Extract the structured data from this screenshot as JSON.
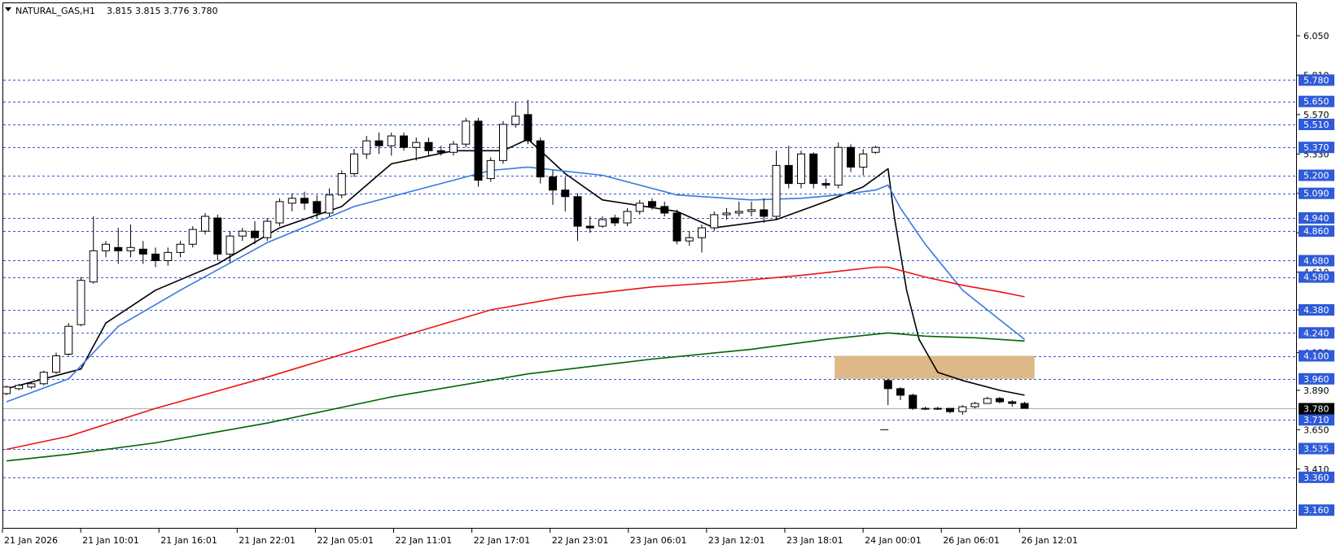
{
  "header": {
    "symbol": "NATURAL_GAS,H1",
    "ohlc": "3.815 3.815 3.776 3.780"
  },
  "price_axis": {
    "ticks": [
      "6.050",
      "5.810",
      "5.570",
      "5.330",
      "5.090",
      "4.850",
      "4.610",
      "4.380",
      "4.120",
      "3.890",
      "3.650",
      "3.410"
    ],
    "level_labels": [
      "5.780",
      "5.650",
      "5.510",
      "5.370",
      "5.200",
      "5.090",
      "4.940",
      "4.860",
      "4.680",
      "4.580",
      "4.380",
      "4.240",
      "4.100",
      "3.960",
      "3.710",
      "3.535",
      "3.360",
      "3.160"
    ],
    "current_price": "3.780"
  },
  "time_axis": {
    "labels": [
      "21 Jan 2026",
      "21 Jan 10:01",
      "21 Jan 16:01",
      "21 Jan 22:01",
      "22 Jan 05:01",
      "22 Jan 11:01",
      "22 Jan 17:01",
      "22 Jan 23:01",
      "23 Jan 06:01",
      "23 Jan 12:01",
      "23 Jan 18:01",
      "24 Jan 00:01",
      "26 Jan 06:01",
      "26 Jan 12:01"
    ]
  },
  "colors": {
    "background": "#ffffff",
    "level_lines": "#2f5bd8",
    "label_box": "#2f5bd8",
    "zone": "#deb887",
    "ma_fast": "#000000",
    "ma_mid": "#3a78e0",
    "ma_slow": "#ee1111",
    "ma_long": "#006400"
  },
  "chart_data": {
    "type": "candlestick",
    "symbol": "NATURAL_GAS",
    "timeframe": "H1",
    "price_range": [
      3.08,
      6.28
    ],
    "candles": [
      {
        "o": 3.87,
        "h": 3.92,
        "l": 3.86,
        "c": 3.91
      },
      {
        "o": 3.9,
        "h": 3.93,
        "l": 3.89,
        "c": 3.92
      },
      {
        "o": 3.91,
        "h": 3.94,
        "l": 3.9,
        "c": 3.93
      },
      {
        "o": 3.93,
        "h": 4.01,
        "l": 3.92,
        "c": 4.0
      },
      {
        "o": 4.0,
        "h": 4.12,
        "l": 3.99,
        "c": 4.1
      },
      {
        "o": 4.11,
        "h": 4.3,
        "l": 4.1,
        "c": 4.28
      },
      {
        "o": 4.29,
        "h": 4.58,
        "l": 4.28,
        "c": 4.56
      },
      {
        "o": 4.55,
        "h": 4.95,
        "l": 4.54,
        "c": 4.74
      },
      {
        "o": 4.74,
        "h": 4.8,
        "l": 4.7,
        "c": 4.78
      },
      {
        "o": 4.76,
        "h": 4.88,
        "l": 4.66,
        "c": 4.74
      },
      {
        "o": 4.74,
        "h": 4.9,
        "l": 4.7,
        "c": 4.76
      },
      {
        "o": 4.75,
        "h": 4.8,
        "l": 4.66,
        "c": 4.72
      },
      {
        "o": 4.72,
        "h": 4.76,
        "l": 4.64,
        "c": 4.68
      },
      {
        "o": 4.68,
        "h": 4.76,
        "l": 4.65,
        "c": 4.73
      },
      {
        "o": 4.73,
        "h": 4.8,
        "l": 4.7,
        "c": 4.78
      },
      {
        "o": 4.78,
        "h": 4.89,
        "l": 4.76,
        "c": 4.87
      },
      {
        "o": 4.86,
        "h": 4.97,
        "l": 4.84,
        "c": 4.95
      },
      {
        "o": 4.94,
        "h": 4.96,
        "l": 4.68,
        "c": 4.72
      },
      {
        "o": 4.72,
        "h": 4.86,
        "l": 4.67,
        "c": 4.83
      },
      {
        "o": 4.83,
        "h": 4.88,
        "l": 4.8,
        "c": 4.86
      },
      {
        "o": 4.86,
        "h": 4.92,
        "l": 4.78,
        "c": 4.82
      },
      {
        "o": 4.82,
        "h": 4.94,
        "l": 4.8,
        "c": 4.92
      },
      {
        "o": 4.91,
        "h": 5.06,
        "l": 4.89,
        "c": 5.04
      },
      {
        "o": 5.03,
        "h": 5.09,
        "l": 4.98,
        "c": 5.06
      },
      {
        "o": 5.06,
        "h": 5.1,
        "l": 4.99,
        "c": 5.03
      },
      {
        "o": 5.04,
        "h": 5.08,
        "l": 4.94,
        "c": 4.97
      },
      {
        "o": 4.97,
        "h": 5.12,
        "l": 4.95,
        "c": 5.08
      },
      {
        "o": 5.08,
        "h": 5.23,
        "l": 5.06,
        "c": 5.21
      },
      {
        "o": 5.21,
        "h": 5.36,
        "l": 5.19,
        "c": 5.33
      },
      {
        "o": 5.33,
        "h": 5.44,
        "l": 5.3,
        "c": 5.41
      },
      {
        "o": 5.41,
        "h": 5.46,
        "l": 5.33,
        "c": 5.38
      },
      {
        "o": 5.38,
        "h": 5.46,
        "l": 5.32,
        "c": 5.44
      },
      {
        "o": 5.44,
        "h": 5.46,
        "l": 5.35,
        "c": 5.37
      },
      {
        "o": 5.37,
        "h": 5.43,
        "l": 5.29,
        "c": 5.4
      },
      {
        "o": 5.4,
        "h": 5.43,
        "l": 5.32,
        "c": 5.35
      },
      {
        "o": 5.35,
        "h": 5.38,
        "l": 5.32,
        "c": 5.34
      },
      {
        "o": 5.34,
        "h": 5.41,
        "l": 5.32,
        "c": 5.39
      },
      {
        "o": 5.39,
        "h": 5.55,
        "l": 5.37,
        "c": 5.53
      },
      {
        "o": 5.53,
        "h": 5.55,
        "l": 5.13,
        "c": 5.17
      },
      {
        "o": 5.18,
        "h": 5.31,
        "l": 5.16,
        "c": 5.29
      },
      {
        "o": 5.29,
        "h": 5.53,
        "l": 5.27,
        "c": 5.51
      },
      {
        "o": 5.51,
        "h": 5.65,
        "l": 5.49,
        "c": 5.56
      },
      {
        "o": 5.57,
        "h": 5.66,
        "l": 5.39,
        "c": 5.41
      },
      {
        "o": 5.41,
        "h": 5.43,
        "l": 5.15,
        "c": 5.19
      },
      {
        "o": 5.19,
        "h": 5.23,
        "l": 5.02,
        "c": 5.11
      },
      {
        "o": 5.11,
        "h": 5.19,
        "l": 4.98,
        "c": 5.07
      },
      {
        "o": 5.07,
        "h": 5.09,
        "l": 4.8,
        "c": 4.89
      },
      {
        "o": 4.89,
        "h": 4.95,
        "l": 4.85,
        "c": 4.88
      },
      {
        "o": 4.89,
        "h": 4.95,
        "l": 4.88,
        "c": 4.93
      },
      {
        "o": 4.94,
        "h": 4.96,
        "l": 4.89,
        "c": 4.91
      },
      {
        "o": 4.91,
        "h": 5.0,
        "l": 4.89,
        "c": 4.98
      },
      {
        "o": 4.98,
        "h": 5.05,
        "l": 4.96,
        "c": 5.03
      },
      {
        "o": 5.04,
        "h": 5.06,
        "l": 4.99,
        "c": 5.01
      },
      {
        "o": 5.01,
        "h": 5.04,
        "l": 4.95,
        "c": 4.97
      },
      {
        "o": 4.97,
        "h": 4.99,
        "l": 4.78,
        "c": 4.8
      },
      {
        "o": 4.8,
        "h": 4.86,
        "l": 4.77,
        "c": 4.82
      },
      {
        "o": 4.82,
        "h": 4.9,
        "l": 4.73,
        "c": 4.88
      },
      {
        "o": 4.88,
        "h": 4.98,
        "l": 4.86,
        "c": 4.96
      },
      {
        "o": 4.96,
        "h": 5.0,
        "l": 4.93,
        "c": 4.97
      },
      {
        "o": 4.97,
        "h": 5.04,
        "l": 4.95,
        "c": 4.98
      },
      {
        "o": 4.98,
        "h": 5.04,
        "l": 4.95,
        "c": 4.99
      },
      {
        "o": 4.99,
        "h": 5.06,
        "l": 4.91,
        "c": 4.95
      },
      {
        "o": 4.95,
        "h": 5.35,
        "l": 4.93,
        "c": 5.26
      },
      {
        "o": 5.26,
        "h": 5.38,
        "l": 5.12,
        "c": 5.15
      },
      {
        "o": 5.15,
        "h": 5.35,
        "l": 5.12,
        "c": 5.33
      },
      {
        "o": 5.33,
        "h": 5.34,
        "l": 5.12,
        "c": 5.15
      },
      {
        "o": 5.15,
        "h": 5.18,
        "l": 5.12,
        "c": 5.14
      },
      {
        "o": 5.14,
        "h": 5.4,
        "l": 5.12,
        "c": 5.37
      },
      {
        "o": 5.37,
        "h": 5.39,
        "l": 5.22,
        "c": 5.25
      },
      {
        "o": 5.25,
        "h": 5.36,
        "l": 5.2,
        "c": 5.33
      },
      {
        "o": 5.34,
        "h": 5.38,
        "l": 5.33,
        "c": 5.37
      },
      {
        "o": 3.95,
        "h": 3.96,
        "l": 3.8,
        "c": 3.9
      },
      {
        "o": 3.9,
        "h": 3.91,
        "l": 3.83,
        "c": 3.86
      },
      {
        "o": 3.86,
        "h": 3.87,
        "l": 3.77,
        "c": 3.78
      },
      {
        "o": 3.78,
        "h": 3.79,
        "l": 3.77,
        "c": 3.78
      },
      {
        "o": 3.78,
        "h": 3.79,
        "l": 3.77,
        "c": 3.78
      },
      {
        "o": 3.78,
        "h": 3.78,
        "l": 3.75,
        "c": 3.76
      },
      {
        "o": 3.76,
        "h": 3.8,
        "l": 3.74,
        "c": 3.79
      },
      {
        "o": 3.79,
        "h": 3.82,
        "l": 3.78,
        "c": 3.81
      },
      {
        "o": 3.81,
        "h": 3.85,
        "l": 3.81,
        "c": 3.84
      },
      {
        "o": 3.84,
        "h": 3.85,
        "l": 3.81,
        "c": 3.82
      },
      {
        "o": 3.82,
        "h": 3.83,
        "l": 3.79,
        "c": 3.81
      },
      {
        "o": 3.81,
        "h": 3.82,
        "l": 3.78,
        "c": 3.78
      }
    ],
    "moving_averages": [
      {
        "color": "#000000",
        "points": [
          [
            0,
            3.9
          ],
          [
            6,
            4.02
          ],
          [
            8,
            4.3
          ],
          [
            12,
            4.5
          ],
          [
            17,
            4.66
          ],
          [
            22,
            4.88
          ],
          [
            27,
            5.01
          ],
          [
            31,
            5.27
          ],
          [
            36,
            5.35
          ],
          [
            40,
            5.35
          ],
          [
            42,
            5.42
          ],
          [
            45,
            5.21
          ],
          [
            48,
            5.05
          ],
          [
            54,
            4.98
          ],
          [
            57,
            4.88
          ],
          [
            62,
            4.93
          ],
          [
            66,
            5.04
          ],
          [
            69,
            5.13
          ],
          [
            71,
            5.24
          ],
          [
            71.5,
            4.95
          ],
          [
            72.5,
            4.5
          ],
          [
            73.5,
            4.2
          ],
          [
            75,
            4.0
          ],
          [
            77,
            3.95
          ],
          [
            80,
            3.89
          ],
          [
            82,
            3.86
          ]
        ]
      },
      {
        "color": "#3a78e0",
        "points": [
          [
            0,
            3.82
          ],
          [
            5,
            3.96
          ],
          [
            9,
            4.28
          ],
          [
            14,
            4.5
          ],
          [
            21,
            4.79
          ],
          [
            28,
            5.01
          ],
          [
            35,
            5.15
          ],
          [
            39,
            5.23
          ],
          [
            42,
            5.25
          ],
          [
            48,
            5.2
          ],
          [
            54,
            5.08
          ],
          [
            60,
            5.05
          ],
          [
            64,
            5.06
          ],
          [
            67,
            5.08
          ],
          [
            70,
            5.11
          ],
          [
            71,
            5.14
          ],
          [
            72,
            5.0
          ],
          [
            74,
            4.78
          ],
          [
            77,
            4.5
          ],
          [
            80,
            4.32
          ],
          [
            82,
            4.2
          ]
        ]
      },
      {
        "color": "#ee1111",
        "points": [
          [
            0,
            3.53
          ],
          [
            5,
            3.61
          ],
          [
            12,
            3.78
          ],
          [
            21,
            3.97
          ],
          [
            31,
            4.2
          ],
          [
            39,
            4.38
          ],
          [
            45,
            4.46
          ],
          [
            52,
            4.52
          ],
          [
            58,
            4.55
          ],
          [
            64,
            4.59
          ],
          [
            70,
            4.64
          ],
          [
            71,
            4.64
          ],
          [
            74,
            4.58
          ],
          [
            77,
            4.53
          ],
          [
            80,
            4.49
          ],
          [
            82,
            4.46
          ]
        ]
      },
      {
        "color": "#006400",
        "points": [
          [
            0,
            3.46
          ],
          [
            5,
            3.5
          ],
          [
            12,
            3.57
          ],
          [
            21,
            3.69
          ],
          [
            31,
            3.85
          ],
          [
            42,
            3.99
          ],
          [
            52,
            4.08
          ],
          [
            60,
            4.14
          ],
          [
            66,
            4.2
          ],
          [
            71,
            4.24
          ],
          [
            74,
            4.22
          ],
          [
            78,
            4.21
          ],
          [
            82,
            4.19
          ]
        ]
      }
    ],
    "horizontal_levels": [
      5.78,
      5.65,
      5.51,
      5.37,
      5.2,
      5.09,
      4.94,
      4.86,
      4.68,
      4.58,
      4.38,
      4.24,
      4.1,
      3.96,
      3.71,
      3.535,
      3.36,
      3.16
    ],
    "zone": {
      "from_bar": 66.7,
      "to_bar": 82.8,
      "low": 3.96,
      "high": 4.1
    },
    "current_price": 3.78,
    "low_dash_price": 3.65,
    "low_dash_bar": 70.7
  }
}
